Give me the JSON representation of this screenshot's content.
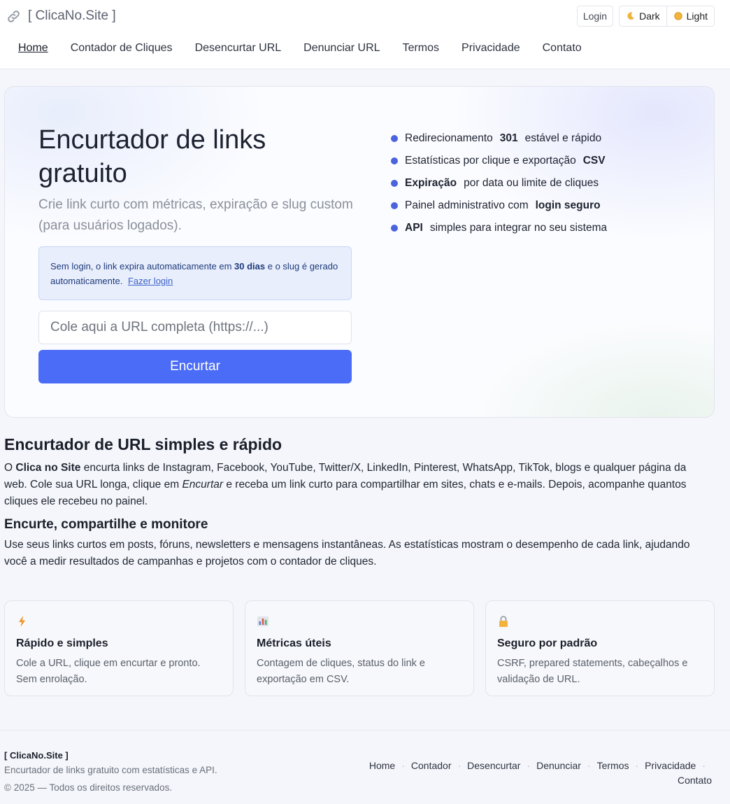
{
  "header": {
    "brand": "[ ClicaNo.Site ]",
    "login": "Login",
    "theme_dark": "Dark",
    "theme_light": "Light",
    "nav": [
      "Home",
      "Contador de Cliques",
      "Desencurtar URL",
      "Denunciar URL",
      "Termos",
      "Privacidade",
      "Contato"
    ]
  },
  "hero": {
    "title": "Encurtador de links gratuito",
    "lead": "Crie link curto com métricas, expiração e slug custom (para usuários logados).",
    "notice_pre": "Sem login, o link expira automaticamente em ",
    "notice_bold": "30 dias",
    "notice_post": " e o slug é gerado automaticamente.",
    "notice_link": "Fazer login",
    "input_placeholder": "Cole aqui a URL completa (https://...)",
    "button": "Encurtar",
    "features": [
      {
        "pre": "Redirecionamento",
        "bold": "301",
        "post": "estável e rápido"
      },
      {
        "pre": "Estatísticas por clique e exportação",
        "bold": "CSV",
        "post": ""
      },
      {
        "pre": "",
        "bold": "Expiração",
        "post": "por data ou limite de cliques"
      },
      {
        "pre": "Painel administrativo com",
        "bold": "login seguro",
        "post": ""
      },
      {
        "pre": "",
        "bold": "API",
        "post": "simples para integrar no seu sistema"
      }
    ]
  },
  "section1": {
    "title": "Encurtador de URL simples e rápido",
    "p_start": "O ",
    "p_bold": "Clica no Site",
    "p_mid": " encurta links de Instagram, Facebook, YouTube, Twitter/X, LinkedIn, Pinterest, WhatsApp, TikTok, blogs e qualquer página da web. Cole sua URL longa, clique em ",
    "p_italic": "Encurtar",
    "p_end": " e receba um link curto para compartilhar em sites, chats e e-mails. Depois, acompanhe quantos cliques ele recebeu no painel."
  },
  "section2": {
    "title": "Encurte, compartilhe e monitore",
    "text": "Use seus links curtos em posts, fóruns, newsletters e mensagens instantâneas. As estatísticas mostram o desempenho de cada link, ajudando você a medir resultados de campanhas e projetos com o contador de cliques."
  },
  "cards": [
    {
      "icon": "lightning-icon",
      "title": "Rápido e simples",
      "text": "Cole a URL, clique em encurtar e pronto. Sem enrolação."
    },
    {
      "icon": "bar-chart-icon",
      "title": "Métricas úteis",
      "text": "Contagem de cliques, status do link e exportação em CSV."
    },
    {
      "icon": "lock-icon",
      "title": "Seguro por padrão",
      "text": "CSRF, prepared statements, cabeçalhos e validação de URL."
    }
  ],
  "footer": {
    "brand": "[ ClicaNo.Site ]",
    "tagline": "Encurtador de links gratuito com estatísticas e API.",
    "copyright": "© 2025 — Todos os direitos reservados.",
    "links": [
      "Home",
      "Contador",
      "Desencurtar",
      "Denunciar",
      "Termos",
      "Privacidade",
      "Contato"
    ]
  },
  "colors": {
    "accent": "#4b6cf7",
    "bullet": "#4b63dd",
    "notice_bg": "#e8eefc"
  }
}
